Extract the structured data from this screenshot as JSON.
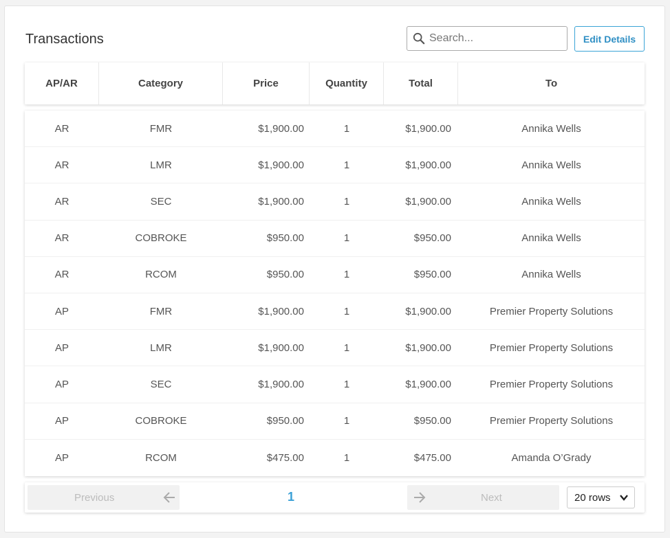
{
  "header": {
    "title": "Transactions",
    "search_placeholder": "Search...",
    "edit_label": "Edit Details"
  },
  "table": {
    "columns": [
      "AP/AR",
      "Category",
      "Price",
      "Quantity",
      "Total",
      "To"
    ],
    "rows": [
      [
        "AR",
        "FMR",
        "$1,900.00",
        "1",
        "$1,900.00",
        "Annika Wells"
      ],
      [
        "AR",
        "LMR",
        "$1,900.00",
        "1",
        "$1,900.00",
        "Annika Wells"
      ],
      [
        "AR",
        "SEC",
        "$1,900.00",
        "1",
        "$1,900.00",
        "Annika Wells"
      ],
      [
        "AR",
        "COBROKE",
        "$950.00",
        "1",
        "$950.00",
        "Annika Wells"
      ],
      [
        "AR",
        "RCOM",
        "$950.00",
        "1",
        "$950.00",
        "Annika Wells"
      ],
      [
        "AP",
        "FMR",
        "$1,900.00",
        "1",
        "$1,900.00",
        "Premier Property Solutions"
      ],
      [
        "AP",
        "LMR",
        "$1,900.00",
        "1",
        "$1,900.00",
        "Premier Property Solutions"
      ],
      [
        "AP",
        "SEC",
        "$1,900.00",
        "1",
        "$1,900.00",
        "Premier Property Solutions"
      ],
      [
        "AP",
        "COBROKE",
        "$950.00",
        "1",
        "$950.00",
        "Premier Property Solutions"
      ],
      [
        "AP",
        "RCOM",
        "$475.00",
        "1",
        "$475.00",
        "Amanda O’Grady"
      ]
    ]
  },
  "pagination": {
    "previous_label": "Previous",
    "page": "1",
    "next_label": "Next",
    "rows_option": "20 rows"
  },
  "colors": {
    "accent": "#3aa0d6",
    "disabled_bg": "#f1f1f1",
    "disabled_text": "#bcbcbc"
  },
  "icons": {
    "search": "search-icon",
    "previous": "arrow-left-icon",
    "next": "arrow-right-icon",
    "select": "chevron-down-icon"
  }
}
